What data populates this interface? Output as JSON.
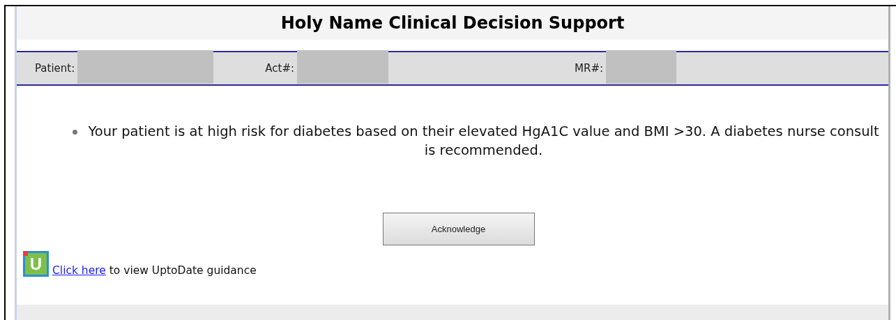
{
  "title": "Holy Name Clinical Decision Support",
  "patient_bar": [
    {
      "label": "Patient:"
    },
    {
      "label": "Act#:"
    },
    {
      "label": "MR#:"
    }
  ],
  "alerts": [
    "Your patient is at high risk for diabetes based on their elevated HgA1C value and BMI >30. A diabetes nurse consult is recommended."
  ],
  "button": "Acknowledge",
  "guidance": {
    "logo_letter": "U",
    "link": "Click here",
    "text": "to view UptoDate guidance"
  }
}
